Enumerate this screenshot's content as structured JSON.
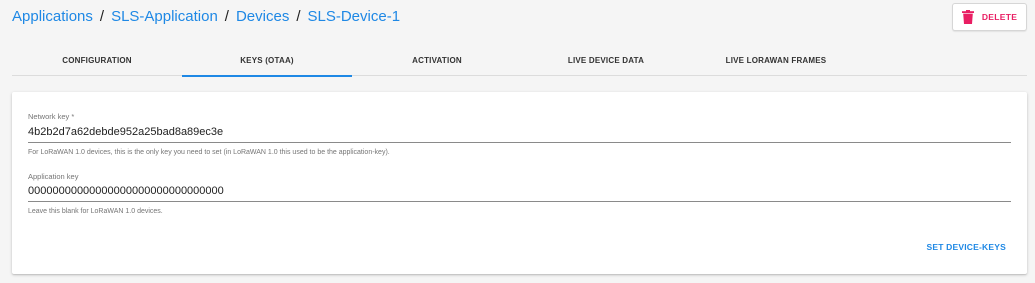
{
  "breadcrumb": {
    "items": [
      "Applications",
      "SLS-Application",
      "Devices"
    ],
    "current": "SLS-Device-1",
    "separator": "/"
  },
  "actions": {
    "delete_label": "DELETE",
    "delete_icon": "trash-icon",
    "delete_color": "#e91e63"
  },
  "tabs": [
    {
      "label": "CONFIGURATION",
      "active": false
    },
    {
      "label": "KEYS (OTAA)",
      "active": true
    },
    {
      "label": "ACTIVATION",
      "active": false
    },
    {
      "label": "LIVE DEVICE DATA",
      "active": false
    },
    {
      "label": "LIVE LORAWAN FRAMES",
      "active": false
    }
  ],
  "form": {
    "network_key": {
      "label": "Network key *",
      "value": "4b2b2d7a62debde952a25bad8a89ec3e",
      "helper": "For LoRaWAN 1.0 devices, this is the only key you need to set (in LoRaWAN 1.0 this used to be the application-key)."
    },
    "application_key": {
      "label": "Application key",
      "value": "00000000000000000000000000000000",
      "helper": "Leave this blank for LoRaWAN 1.0 devices."
    },
    "submit_label": "SET DEVICE-KEYS"
  },
  "colors": {
    "accent": "#1e88e5",
    "background": "#f5f5f5"
  }
}
